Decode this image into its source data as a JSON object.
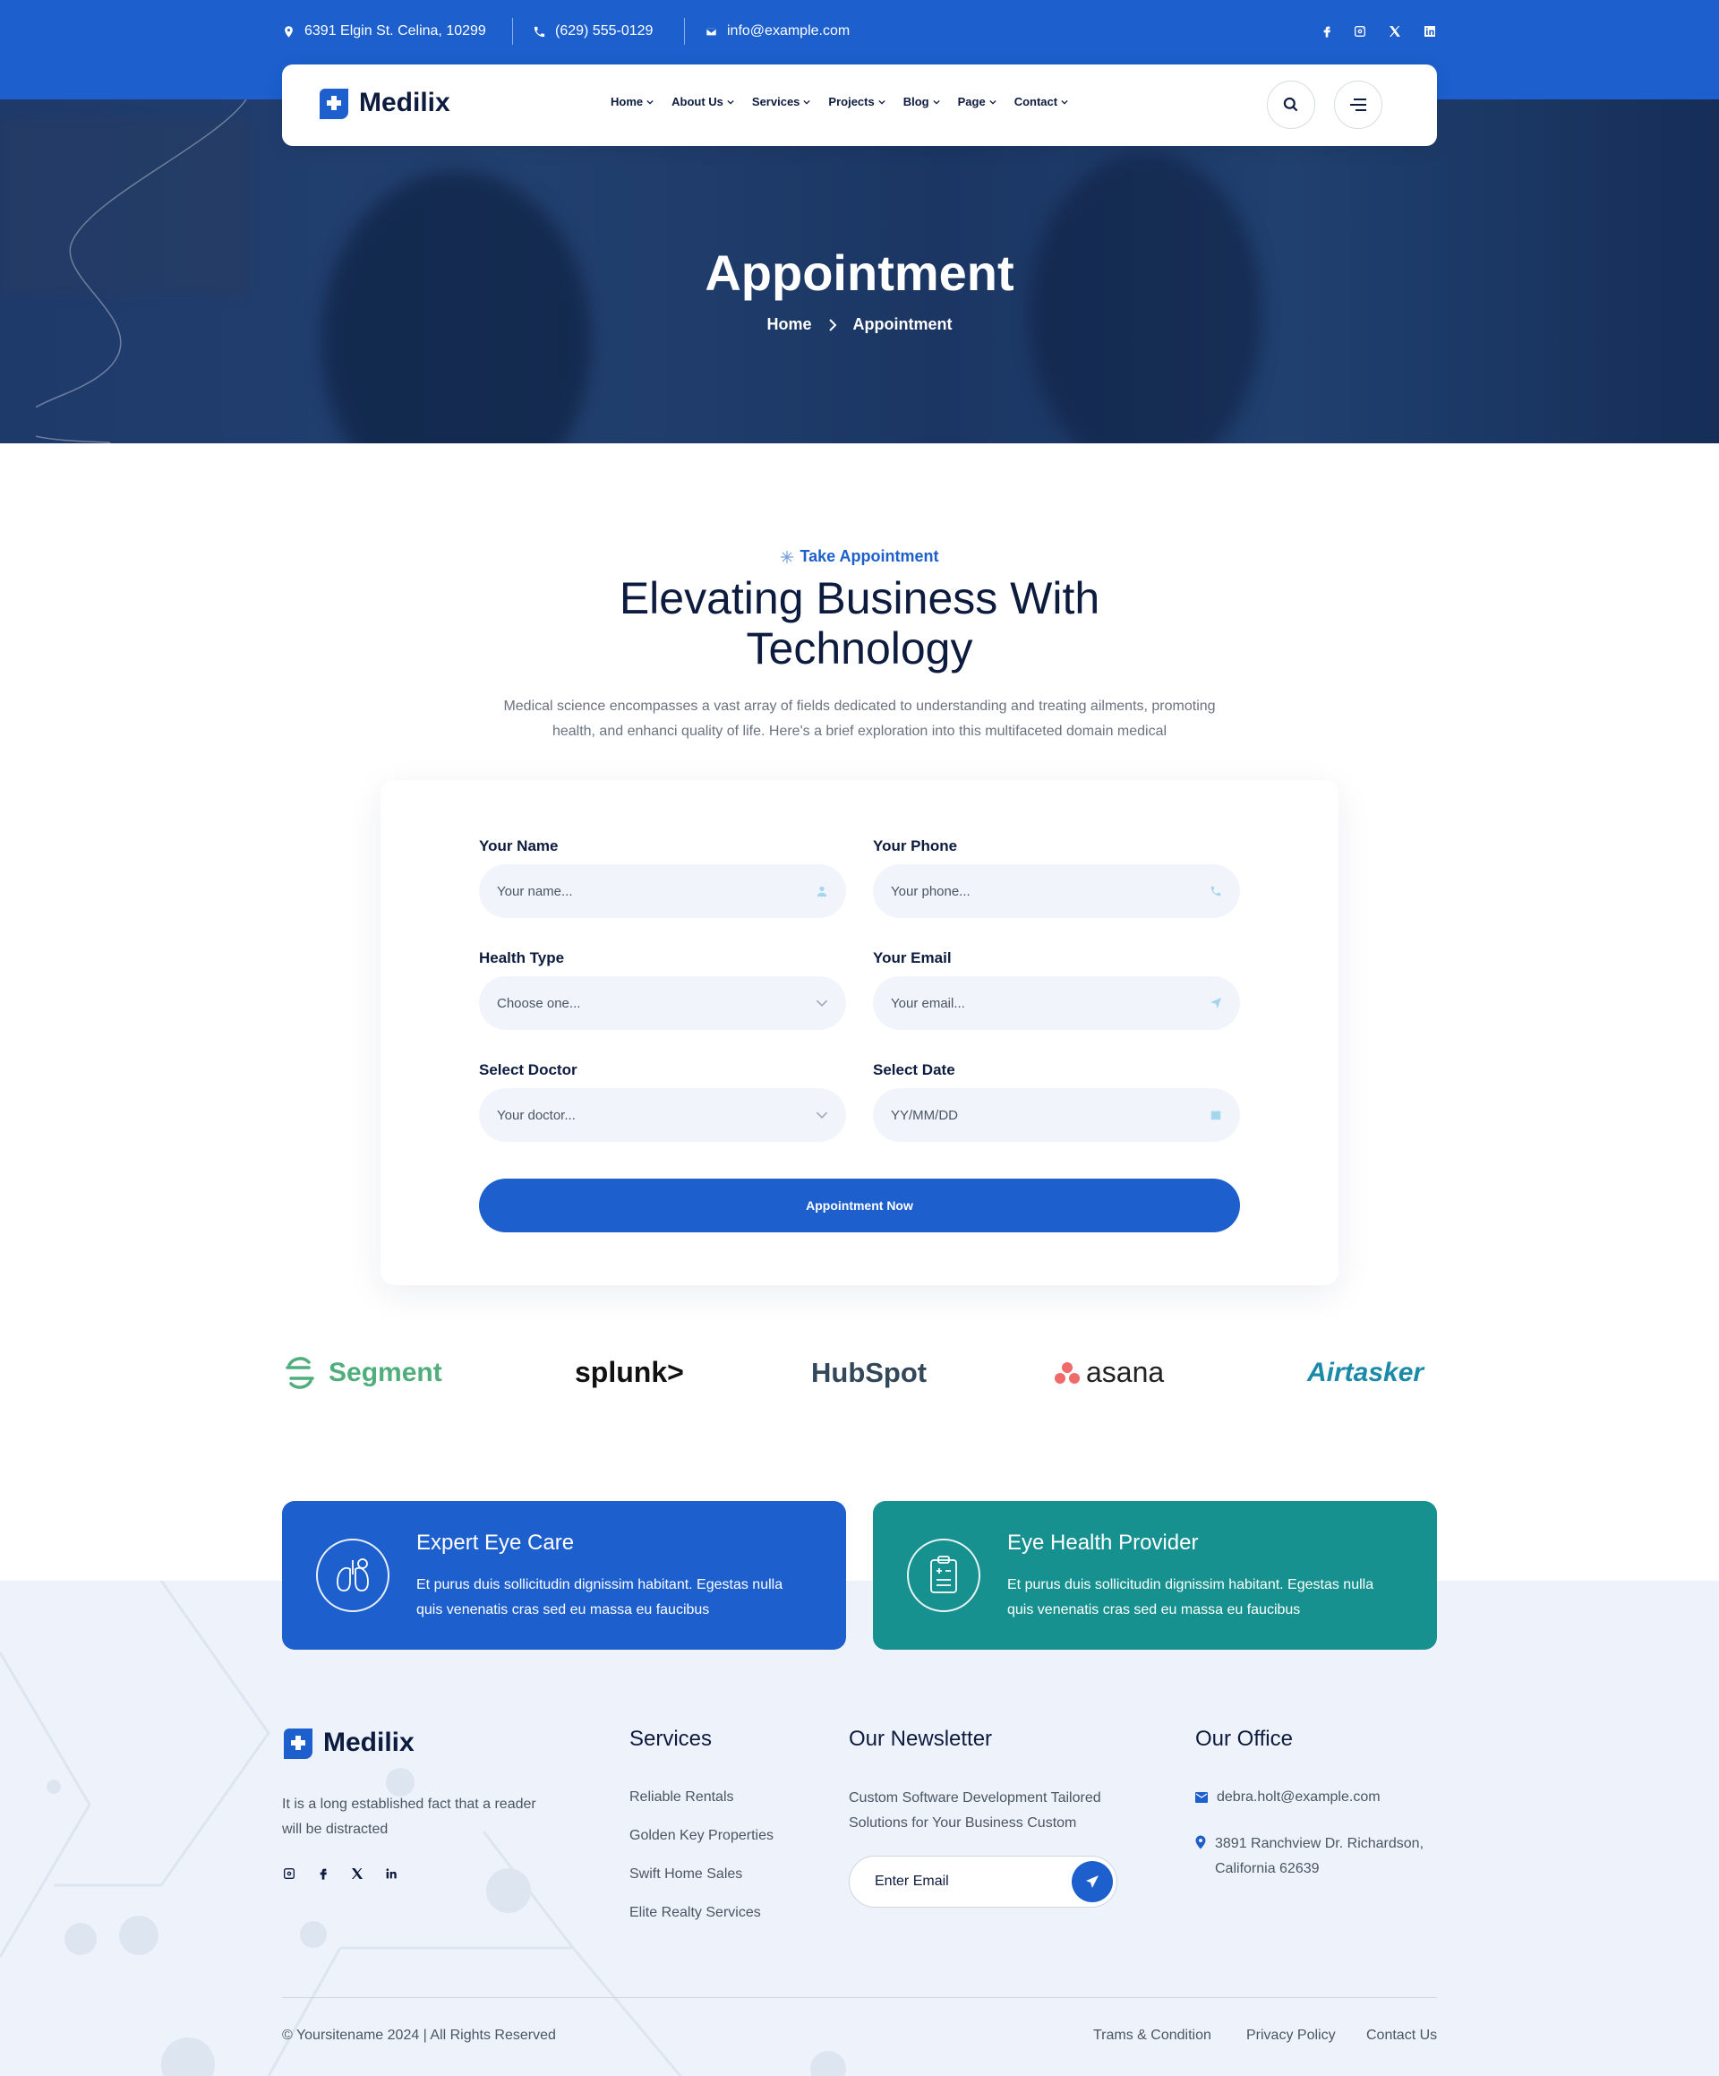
{
  "topbar": {
    "address": "6391 Elgin St. Celina, 10299",
    "phone": "(629) 555-0129",
    "email": "info@example.com",
    "social_icons": [
      "facebook-icon",
      "instagram-icon",
      "x-icon",
      "linkedin-icon"
    ]
  },
  "nav": {
    "brand": "Medilix",
    "links": [
      "Home",
      "About Us",
      "Services",
      "Projects",
      "Blog",
      "Page",
      "Contact"
    ]
  },
  "hero": {
    "title": "Appointment",
    "breadcrumb": [
      "Home",
      "Appointment"
    ]
  },
  "appointment": {
    "tag": "Take Appointment",
    "title": "Elevating Business With Technology",
    "description": "Medical science encompasses a vast array of fields dedicated to understanding and treating ailments, promoting health, and enhanci quality of life. Here's a brief exploration into this multifaceted domain medical",
    "fields": {
      "name_label": "Your Name",
      "name_placeholder": "Your name...",
      "phone_label": "Your Phone",
      "phone_placeholder": "Your phone...",
      "health_label": "Health Type",
      "health_placeholder": "Choose one...",
      "email_label": "Your Email",
      "email_placeholder": "Your email...",
      "doctor_label": "Select Doctor",
      "doctor_placeholder": "Your doctor...",
      "date_label": "Select Date",
      "date_placeholder": "YY/MM/DD"
    },
    "submit": "Appointment Now"
  },
  "brands": [
    "Segment",
    "splunk>",
    "HubSpot",
    "asana",
    "Airtasker"
  ],
  "cards": [
    {
      "title": "Expert Eye Care",
      "text": "Et purus duis sollicitudin dignissim habitant. Egestas nulla quis venenatis cras sed eu massa eu faucibus",
      "color": "#1c5fcd"
    },
    {
      "title": "Eye Health Provider",
      "text": "Et purus duis sollicitudin dignissim habitant. Egestas nulla quis venenatis cras sed eu massa eu faucibus",
      "color": "#17918f"
    }
  ],
  "footer": {
    "brand": "Medilix",
    "about": "It is a long established fact that a reader will be distracted",
    "services_title": "Services",
    "services": [
      "Reliable Rentals",
      "Golden Key Properties",
      "Swift Home Sales",
      "Elite Realty Services"
    ],
    "newsletter_title": "Our Newsletter",
    "newsletter_text": "Custom Software Development Tailored Solutions for Your Business Custom",
    "newsletter_placeholder": "Enter Email",
    "office_title": "Our Office",
    "office_email": "debra.holt@example.com",
    "office_address": "3891 Ranchview Dr. Richardson, California 62639",
    "copyright": "© Yoursitename  2024 | All Rights Reserved",
    "bottom_links": [
      "Trams & Condition",
      "Privacy Policy",
      "Contact Us"
    ]
  },
  "colors": {
    "primary": "#1c5fcd",
    "teal": "#17918f",
    "navy": "#0d1b3e"
  }
}
